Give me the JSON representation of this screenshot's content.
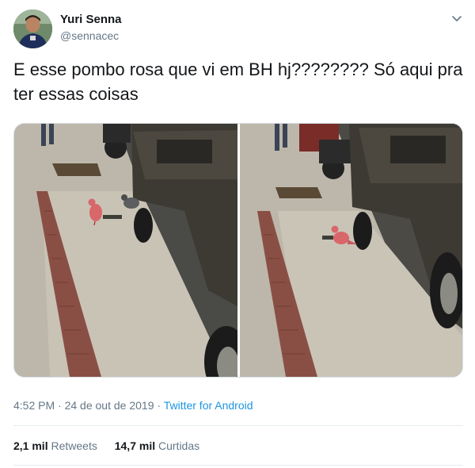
{
  "author": {
    "display_name": "Yuri Senna",
    "handle": "@sennacec",
    "avatar": "avatar-photo"
  },
  "menu_icon": "chevron-down-icon",
  "tweet": {
    "text": "E esse pombo rosa que vi em BH hj???????? Só aqui pra ter essas coisas"
  },
  "media": {
    "photo_count": 2,
    "photos": [
      {
        "subject": "pink pigeon and grey pigeon on sidewalk next to dark pickup truck"
      },
      {
        "subject": "pink pigeon on sidewalk next to dark pickup truck"
      }
    ]
  },
  "meta": {
    "time": "4:52 PM",
    "separator": "·",
    "date": "24 de out de 2019",
    "source": "Twitter for Android"
  },
  "stats": {
    "retweets_count": "2,1 mil",
    "retweets_label": "Retweets",
    "likes_count": "14,7 mil",
    "likes_label": "Curtidas"
  },
  "colors": {
    "link": "#1b95e0",
    "secondary_text": "#657786",
    "primary_text": "#14171a"
  }
}
